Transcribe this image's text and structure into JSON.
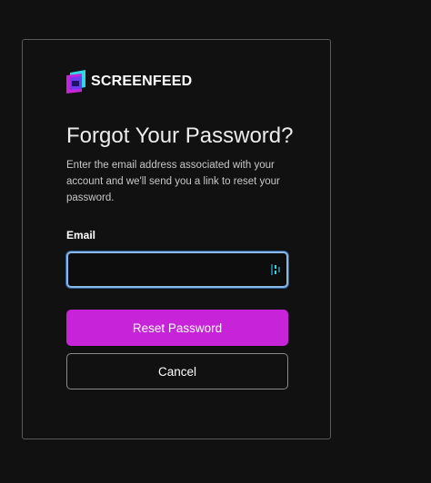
{
  "brand": {
    "name": "SCREENFEED",
    "colors": {
      "cyan": "#2fd6e8",
      "magenta": "#c724d9",
      "purple": "#6b3cf0"
    }
  },
  "page": {
    "title": "Forgot Your Password?",
    "description": "Enter the email address associated with your account and we'll send you a link to reset your password."
  },
  "form": {
    "email_label": "Email",
    "email_value": "",
    "email_placeholder": "",
    "password_manager_icon": "password-manager-icon"
  },
  "buttons": {
    "reset_label": "Reset Password",
    "cancel_label": "Cancel"
  },
  "colors": {
    "background": "#111111",
    "primary_button": "#c724d9",
    "focus_ring": "#8ab8e6"
  }
}
